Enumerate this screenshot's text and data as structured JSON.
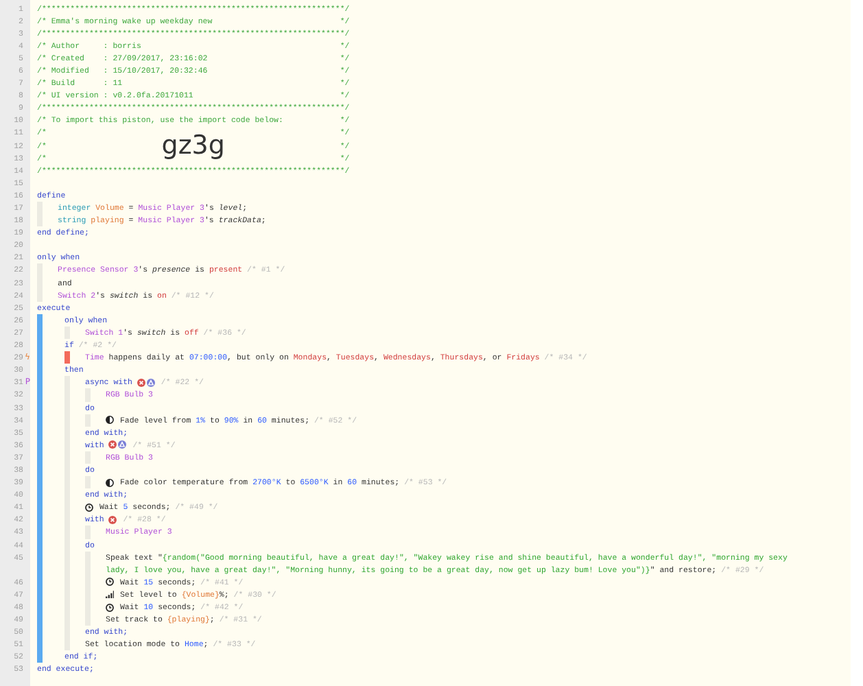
{
  "lines": [
    {
      "number": "1",
      "tokens": [
        {
          "kind": "hdr",
          "text": "/****************************************************************/"
        }
      ]
    },
    {
      "number": "2",
      "tokens": [
        {
          "kind": "hdr",
          "text": "/* Emma's morning wake up weekday new"
        },
        {
          "kind": "hdr",
          "text": "*/"
        }
      ]
    },
    {
      "number": "3",
      "tokens": [
        {
          "kind": "hdr",
          "text": "/****************************************************************/"
        }
      ]
    },
    {
      "number": "4",
      "tokens": [
        {
          "kind": "hdr",
          "text": "/* Author     : borris"
        },
        {
          "kind": "hdr",
          "text": "*/"
        }
      ]
    },
    {
      "number": "5",
      "tokens": [
        {
          "kind": "hdr",
          "text": "/* Created    : 27/09/2017, 23:16:02"
        },
        {
          "kind": "hdr",
          "text": "*/"
        }
      ]
    },
    {
      "number": "6",
      "tokens": [
        {
          "kind": "hdr",
          "text": "/* Modified   : 15/10/2017, 20:32:46"
        },
        {
          "kind": "hdr",
          "text": "*/"
        }
      ]
    },
    {
      "number": "7",
      "tokens": [
        {
          "kind": "hdr",
          "text": "/* Build      : 11"
        },
        {
          "kind": "hdr",
          "text": "*/"
        }
      ]
    },
    {
      "number": "8",
      "tokens": [
        {
          "kind": "hdr",
          "text": "/* UI version : v0.2.0fa.20171011"
        },
        {
          "kind": "hdr",
          "text": "*/"
        }
      ]
    },
    {
      "number": "9",
      "tokens": [
        {
          "kind": "hdr",
          "text": "/****************************************************************/"
        }
      ]
    },
    {
      "number": "10",
      "tokens": [
        {
          "kind": "hdr",
          "text": "/* To import this piston, use the import code below:"
        },
        {
          "kind": "hdr",
          "text": "*/"
        }
      ]
    },
    {
      "number": "11",
      "tokens": [
        {
          "kind": "hdr",
          "text": "/*"
        },
        {
          "kind": "hdr",
          "text": "*/"
        }
      ]
    },
    {
      "number": "12",
      "tokens": [
        {
          "kind": "hdr",
          "text": "/*"
        },
        {
          "kind": "code",
          "text": "gz3g"
        },
        {
          "kind": "hdr",
          "text": "*/"
        }
      ]
    },
    {
      "number": "13",
      "tokens": [
        {
          "kind": "hdr",
          "text": "/*"
        },
        {
          "kind": "hdr",
          "text": "*/"
        }
      ]
    },
    {
      "number": "14",
      "tokens": [
        {
          "kind": "hdr",
          "text": "/****************************************************************/"
        }
      ]
    },
    {
      "number": "15"
    },
    {
      "number": "16",
      "tokens": [
        {
          "kind": "kw",
          "text": "define"
        }
      ],
      "children": [
        {
          "number": "17",
          "tokens": [
            {
              "kind": "type",
              "text": "integer "
            },
            {
              "kind": "var",
              "text": "Volume"
            },
            {
              "kind": "plain",
              "text": " = "
            },
            {
              "kind": "dev",
              "text": "Music Player 3"
            },
            {
              "kind": "plain",
              "text": "'s "
            },
            {
              "kind": "attr",
              "text": "level"
            },
            {
              "kind": "plain",
              "text": ";"
            }
          ]
        },
        {
          "number": "18",
          "tokens": [
            {
              "kind": "type",
              "text": "string "
            },
            {
              "kind": "var",
              "text": "playing"
            },
            {
              "kind": "plain",
              "text": " = "
            },
            {
              "kind": "dev",
              "text": "Music Player 3"
            },
            {
              "kind": "plain",
              "text": "'s "
            },
            {
              "kind": "attr",
              "text": "trackData"
            },
            {
              "kind": "plain",
              "text": ";"
            }
          ]
        }
      ]
    },
    {
      "number": "19",
      "tokens": [
        {
          "kind": "kw",
          "text": "end define;"
        }
      ]
    },
    {
      "number": "20"
    },
    {
      "number": "21",
      "tokens": [
        {
          "kind": "kw",
          "text": "only when"
        }
      ],
      "children": [
        {
          "number": "22",
          "tokens": [
            {
              "kind": "dev",
              "text": "Presence Sensor 3"
            },
            {
              "kind": "plain",
              "text": "'s "
            },
            {
              "kind": "attr",
              "text": "presence"
            },
            {
              "kind": "plain",
              "text": " is "
            },
            {
              "kind": "val",
              "text": "present"
            },
            {
              "kind": "cmt",
              "text": " /* #1 */"
            }
          ]
        },
        {
          "number": "23",
          "tokens": [
            {
              "kind": "plain",
              "text": "and"
            }
          ]
        },
        {
          "number": "24",
          "tokens": [
            {
              "kind": "dev",
              "text": "Switch 2"
            },
            {
              "kind": "plain",
              "text": "'s "
            },
            {
              "kind": "attr",
              "text": "switch"
            },
            {
              "kind": "plain",
              "text": " is "
            },
            {
              "kind": "val",
              "text": "on"
            },
            {
              "kind": "cmt",
              "text": " /* #12 */"
            }
          ]
        }
      ]
    },
    {
      "number": "25",
      "tokens": [
        {
          "kind": "kw",
          "text": "execute"
        }
      ],
      "kind": "execute",
      "children": [
        {
          "number": "26",
          "tokens": [
            {
              "kind": "kw",
              "text": "only when"
            }
          ],
          "children": [
            {
              "number": "27",
              "tokens": [
                {
                  "kind": "dev",
                  "text": "Switch 1"
                },
                {
                  "kind": "plain",
                  "text": "'s "
                },
                {
                  "kind": "attr",
                  "text": "switch"
                },
                {
                  "kind": "plain",
                  "text": " is "
                },
                {
                  "kind": "val",
                  "text": "off"
                },
                {
                  "kind": "cmt",
                  "text": " /* #36 */"
                }
              ]
            }
          ]
        },
        {
          "number": "28",
          "tokens": [
            {
              "kind": "kw",
              "text": "if "
            },
            {
              "kind": "cmt",
              "text": "/* #2 */"
            }
          ],
          "kind": "condition",
          "children": [
            {
              "number": "29",
              "gutter_mark": {
                "text": "ϟ",
                "color": "#e8833a"
              },
              "tokens": [
                {
                  "kind": "dev",
                  "text": "Time"
                },
                {
                  "kind": "plain",
                  "text": " happens daily at "
                },
                {
                  "kind": "num",
                  "text": "07:00:00"
                },
                {
                  "kind": "plain",
                  "text": ", but only on "
                },
                {
                  "kind": "val",
                  "text": "Mondays"
                },
                {
                  "kind": "plain",
                  "text": ", "
                },
                {
                  "kind": "val",
                  "text": "Tuesdays"
                },
                {
                  "kind": "plain",
                  "text": ", "
                },
                {
                  "kind": "val",
                  "text": "Wednesdays"
                },
                {
                  "kind": "plain",
                  "text": ", "
                },
                {
                  "kind": "val",
                  "text": "Thursdays"
                },
                {
                  "kind": "plain",
                  "text": ", or "
                },
                {
                  "kind": "val",
                  "text": "Fridays"
                },
                {
                  "kind": "cmt",
                  "text": " /* #34 */"
                }
              ]
            }
          ]
        },
        {
          "number": "30",
          "tokens": [
            {
              "kind": "kw",
              "text": "then"
            }
          ],
          "children": [
            {
              "number": "31",
              "gutter_mark": {
                "text": "P",
                "color": "#b04fd8"
              },
              "tokens": [
                {
                  "kind": "kw",
                  "text": "async with "
                },
                {
                  "kind": "x_icon"
                },
                {
                  "kind": "a_icon"
                },
                {
                  "kind": "cmt",
                  "text": " /* #22 */"
                }
              ],
              "children": [
                {
                  "number": "32",
                  "tokens": [
                    {
                      "kind": "dev",
                      "text": "RGB Bulb 3"
                    }
                  ]
                }
              ]
            },
            {
              "number": "33",
              "tokens": [
                {
                  "kind": "kw",
                  "text": "do"
                }
              ],
              "children": [
                {
                  "number": "34",
                  "tokens": [
                    {
                      "kind": "fade_icon"
                    },
                    {
                      "kind": "plain",
                      "text": " Fade level from "
                    },
                    {
                      "kind": "num",
                      "text": "1%"
                    },
                    {
                      "kind": "plain",
                      "text": " to "
                    },
                    {
                      "kind": "num",
                      "text": "90%"
                    },
                    {
                      "kind": "plain",
                      "text": " in "
                    },
                    {
                      "kind": "num",
                      "text": "60"
                    },
                    {
                      "kind": "plain",
                      "text": " minutes; "
                    },
                    {
                      "kind": "cmt",
                      "text": "/* #52 */"
                    }
                  ]
                }
              ]
            },
            {
              "number": "35",
              "tokens": [
                {
                  "kind": "kw",
                  "text": "end with;"
                }
              ]
            },
            {
              "number": "36",
              "tokens": [
                {
                  "kind": "kw",
                  "text": "with "
                },
                {
                  "kind": "x_icon"
                },
                {
                  "kind": "a_icon"
                },
                {
                  "kind": "cmt",
                  "text": " /* #51 */"
                }
              ],
              "children": [
                {
                  "number": "37",
                  "tokens": [
                    {
                      "kind": "dev",
                      "text": "RGB Bulb 3"
                    }
                  ]
                }
              ]
            },
            {
              "number": "38",
              "tokens": [
                {
                  "kind": "kw",
                  "text": "do"
                }
              ],
              "children": [
                {
                  "number": "39",
                  "tokens": [
                    {
                      "kind": "fade_icon"
                    },
                    {
                      "kind": "plain",
                      "text": " Fade color temperature from "
                    },
                    {
                      "kind": "num",
                      "text": "2700°K"
                    },
                    {
                      "kind": "plain",
                      "text": " to "
                    },
                    {
                      "kind": "num",
                      "text": "6500°K"
                    },
                    {
                      "kind": "plain",
                      "text": " in "
                    },
                    {
                      "kind": "num",
                      "text": "60"
                    },
                    {
                      "kind": "plain",
                      "text": " minutes; "
                    },
                    {
                      "kind": "cmt",
                      "text": "/* #53 */"
                    }
                  ]
                }
              ]
            },
            {
              "number": "40",
              "tokens": [
                {
                  "kind": "kw",
                  "text": "end with;"
                }
              ]
            },
            {
              "number": "41",
              "tokens": [
                {
                  "kind": "clock_icon"
                },
                {
                  "kind": "plain",
                  "text": " Wait "
                },
                {
                  "kind": "num",
                  "text": "5"
                },
                {
                  "kind": "plain",
                  "text": " seconds; "
                },
                {
                  "kind": "cmt",
                  "text": "/* #49 */"
                }
              ]
            },
            {
              "number": "42",
              "tokens": [
                {
                  "kind": "kw",
                  "text": "with "
                },
                {
                  "kind": "x_icon"
                },
                {
                  "kind": "cmt",
                  "text": " /* #28 */"
                }
              ],
              "children": [
                {
                  "number": "43",
                  "tokens": [
                    {
                      "kind": "dev",
                      "text": "Music Player 3"
                    }
                  ]
                }
              ]
            },
            {
              "number": "44",
              "tokens": [
                {
                  "kind": "kw",
                  "text": "do"
                }
              ],
              "children": [
                {
                  "number": "45",
                  "tokens": [
                    {
                      "kind": "plain",
                      "text": "Speak text \""
                    },
                    {
                      "kind": "str",
                      "text": "{random(\"Good morning beautiful, have a great day!\", \"Wakey wakey rise and shine beautiful, have a wonderful day!\", \"morning my sexy"
                    }
                  ],
                  "continuation": [
                    {
                      "kind": "str",
                      "text": "lady, I love you, have a great day!\", \"Morning hunny, its going to be a great day, now get up lazy bum! Love you\")}"
                    },
                    {
                      "kind": "plain",
                      "text": "\" and restore; "
                    },
                    {
                      "kind": "cmt",
                      "text": "/* #29 */"
                    }
                  ]
                },
                {
                  "number": "46",
                  "tokens": [
                    {
                      "kind": "clock_icon"
                    },
                    {
                      "kind": "plain",
                      "text": " Wait "
                    },
                    {
                      "kind": "num",
                      "text": "15"
                    },
                    {
                      "kind": "plain",
                      "text": " seconds; "
                    },
                    {
                      "kind": "cmt",
                      "text": "/* #41 */"
                    }
                  ]
                },
                {
                  "number": "47",
                  "tokens": [
                    {
                      "kind": "level_icon"
                    },
                    {
                      "kind": "plain",
                      "text": " Set level to "
                    },
                    {
                      "kind": "var",
                      "text": "{Volume}"
                    },
                    {
                      "kind": "plain",
                      "text": "%; "
                    },
                    {
                      "kind": "cmt",
                      "text": "/* #30 */"
                    }
                  ]
                },
                {
                  "number": "48",
                  "tokens": [
                    {
                      "kind": "clock_icon"
                    },
                    {
                      "kind": "plain",
                      "text": " Wait "
                    },
                    {
                      "kind": "num",
                      "text": "10"
                    },
                    {
                      "kind": "plain",
                      "text": " seconds; "
                    },
                    {
                      "kind": "cmt",
                      "text": "/* #42 */"
                    }
                  ]
                },
                {
                  "number": "49",
                  "tokens": [
                    {
                      "kind": "plain",
                      "text": "Set track to "
                    },
                    {
                      "kind": "var",
                      "text": "{playing}"
                    },
                    {
                      "kind": "plain",
                      "text": "; "
                    },
                    {
                      "kind": "cmt",
                      "text": "/* #31 */"
                    }
                  ]
                }
              ]
            },
            {
              "number": "50",
              "tokens": [
                {
                  "kind": "kw",
                  "text": "end with;"
                }
              ]
            },
            {
              "number": "51",
              "tokens": [
                {
                  "kind": "plain",
                  "text": "Set location mode to "
                },
                {
                  "kind": "num",
                  "text": "Home"
                },
                {
                  "kind": "plain",
                  "text": "; "
                },
                {
                  "kind": "cmt",
                  "text": "/* #33 */"
                }
              ]
            }
          ]
        },
        {
          "number": "52",
          "tokens": [
            {
              "kind": "kw",
              "text": "end if;"
            }
          ]
        }
      ]
    },
    {
      "number": "53",
      "tokens": [
        {
          "kind": "kw",
          "text": "end execute;"
        }
      ]
    }
  ]
}
